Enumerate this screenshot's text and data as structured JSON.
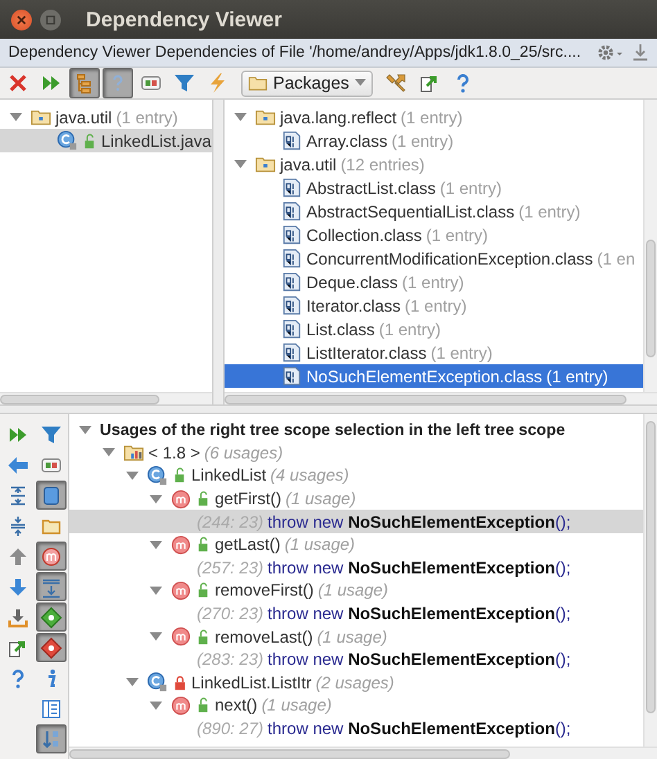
{
  "window": {
    "title": "Dependency Viewer"
  },
  "header": {
    "title": "Dependency Viewer Dependencies of File '/home/andrey/Apps/jdk1.8.0_25/src...."
  },
  "toolbar": {
    "buttons": [
      {
        "kind": "close",
        "pressed": false
      },
      {
        "kind": "rerun",
        "pressed": false
      },
      {
        "kind": "flatten",
        "pressed": true
      },
      {
        "kind": "help-toggle",
        "pressed": true
      },
      {
        "kind": "module",
        "pressed": false
      },
      {
        "kind": "filter",
        "pressed": false
      },
      {
        "kind": "lightning",
        "pressed": false
      },
      {
        "kind": "dropdown",
        "label": "Packages"
      },
      {
        "kind": "wrench",
        "pressed": false
      },
      {
        "kind": "export",
        "pressed": false
      },
      {
        "kind": "help",
        "pressed": false
      }
    ]
  },
  "left_tree": {
    "nodes": [
      {
        "kind": "package",
        "name": "java.util",
        "count": "(1 entry)",
        "expanded": true,
        "selected": false,
        "children": [
          {
            "kind": "source",
            "name": "LinkedList.java",
            "locked": false,
            "selected": true
          }
        ]
      }
    ]
  },
  "right_tree": {
    "nodes": [
      {
        "kind": "package",
        "name": "java.lang.reflect",
        "count": "(1 entry)",
        "expanded": true,
        "selected": false,
        "children": [
          {
            "kind": "class-file",
            "name": "Array.class",
            "count": "(1 entry)",
            "selected": false
          }
        ]
      },
      {
        "kind": "package",
        "name": "java.util",
        "count": "(12 entries)",
        "expanded": true,
        "selected": false,
        "children": [
          {
            "kind": "class-file",
            "name": "AbstractList.class",
            "count": "(1 entry)",
            "selected": false
          },
          {
            "kind": "class-file",
            "name": "AbstractSequentialList.class",
            "count": "(1 entry)",
            "selected": false
          },
          {
            "kind": "class-file",
            "name": "Collection.class",
            "count": "(1 entry)",
            "selected": false
          },
          {
            "kind": "class-file",
            "name": "ConcurrentModificationException.class",
            "count": "(1 en",
            "selected": false
          },
          {
            "kind": "class-file",
            "name": "Deque.class",
            "count": "(1 entry)",
            "selected": false
          },
          {
            "kind": "class-file",
            "name": "Iterator.class",
            "count": "(1 entry)",
            "selected": false
          },
          {
            "kind": "class-file",
            "name": "List.class",
            "count": "(1 entry)",
            "selected": false
          },
          {
            "kind": "class-file",
            "name": "ListIterator.class",
            "count": "(1 entry)",
            "selected": false
          },
          {
            "kind": "class-file",
            "name": "NoSuchElementException.class",
            "count": "(1 entry)",
            "selected": true
          }
        ]
      }
    ]
  },
  "side_toolbar": {
    "column_1": [
      {
        "kind": "rerun",
        "pressed": false
      },
      {
        "kind": "back",
        "pressed": false
      },
      {
        "kind": "expand-all",
        "pressed": false
      },
      {
        "kind": "collapse-all",
        "pressed": false
      },
      {
        "kind": "up",
        "pressed": false
      },
      {
        "kind": "down",
        "pressed": false
      },
      {
        "kind": "import",
        "pressed": false
      },
      {
        "kind": "export",
        "pressed": false
      },
      {
        "kind": "help",
        "pressed": false
      }
    ],
    "column_2": [
      {
        "kind": "filter",
        "pressed": false
      },
      {
        "kind": "module",
        "pressed": false
      },
      {
        "kind": "square",
        "pressed": true
      },
      {
        "kind": "bracket",
        "pressed": false
      },
      {
        "kind": "method",
        "pressed": true
      },
      {
        "kind": "align",
        "pressed": true
      },
      {
        "kind": "diamond-green",
        "pressed": true
      },
      {
        "kind": "diamond-red",
        "pressed": true
      },
      {
        "kind": "info",
        "pressed": false
      },
      {
        "kind": "layout",
        "pressed": false
      },
      {
        "kind": "sort",
        "pressed": true
      }
    ]
  },
  "usages_tree": {
    "nodes": [
      {
        "kind": "group",
        "name": "Usages of the right tree scope selection in the left tree scope",
        "expanded": true,
        "selected": false,
        "children": [
          {
            "kind": "module",
            "name": "< 1.8 >",
            "count": "(6 usages)",
            "expanded": true,
            "selected": false,
            "children": [
              {
                "kind": "class",
                "name": "LinkedList",
                "count": "(4 usages)",
                "locked": false,
                "expanded": true,
                "selected": false,
                "children": [
                  {
                    "kind": "method",
                    "name": "getFirst()",
                    "count": "(1 usage)",
                    "locked": false,
                    "expanded": true,
                    "selected": false,
                    "children": [
                      {
                        "kind": "usage",
                        "location": "(244: 23)",
                        "code": "throw new **NoSuchElementException**();",
                        "selected": true
                      }
                    ]
                  },
                  {
                    "kind": "method",
                    "name": "getLast()",
                    "count": "(1 usage)",
                    "locked": false,
                    "expanded": true,
                    "selected": false,
                    "children": [
                      {
                        "kind": "usage",
                        "location": "(257: 23)",
                        "code": "throw new **NoSuchElementException**();",
                        "selected": false
                      }
                    ]
                  },
                  {
                    "kind": "method",
                    "name": "removeFirst()",
                    "count": "(1 usage)",
                    "locked": false,
                    "expanded": true,
                    "selected": false,
                    "children": [
                      {
                        "kind": "usage",
                        "location": "(270: 23)",
                        "code": "throw new **NoSuchElementException**();",
                        "selected": false
                      }
                    ]
                  },
                  {
                    "kind": "method",
                    "name": "removeLast()",
                    "count": "(1 usage)",
                    "locked": false,
                    "expanded": true,
                    "selected": false,
                    "children": [
                      {
                        "kind": "usage",
                        "location": "(283: 23)",
                        "code": "throw new **NoSuchElementException**();",
                        "selected": false
                      }
                    ]
                  }
                ]
              },
              {
                "kind": "class",
                "name": "LinkedList.ListItr",
                "count": "(2 usages)",
                "locked": true,
                "expanded": true,
                "selected": false,
                "children": [
                  {
                    "kind": "method",
                    "name": "next()",
                    "count": "(1 usage)",
                    "locked": false,
                    "expanded": true,
                    "selected": false,
                    "children": [
                      {
                        "kind": "usage",
                        "location": "(890: 27)",
                        "code": "throw new **NoSuchElementException**();",
                        "selected": false
                      }
                    ]
                  }
                ]
              }
            ]
          }
        ]
      }
    ]
  }
}
